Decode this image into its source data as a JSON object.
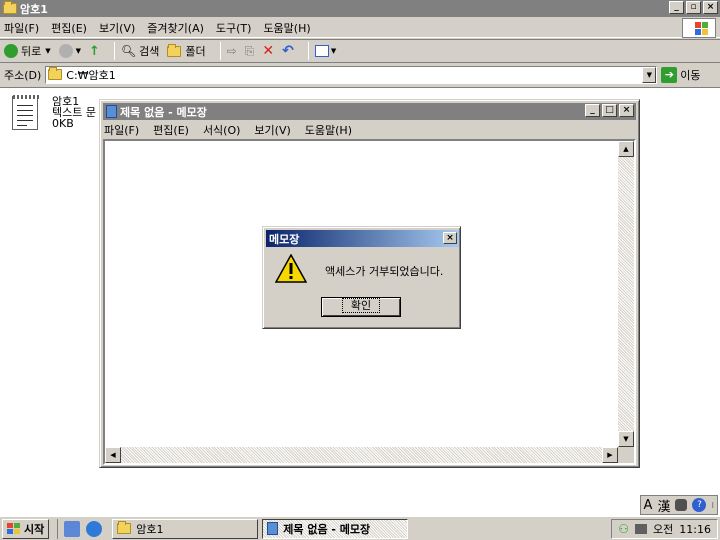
{
  "explorer": {
    "title": "암호1",
    "menu": [
      "파일(F)",
      "편집(E)",
      "보기(V)",
      "즐겨찾기(A)",
      "도구(T)",
      "도움말(H)"
    ],
    "toolbar": {
      "back": "뒤로",
      "search": "검색",
      "folders": "폴더"
    },
    "address": {
      "label": "주소(D)",
      "value": "C:₩암호1",
      "go": "이동"
    },
    "file": {
      "name": "암호1",
      "type": "텍스트 문",
      "size": "0KB"
    }
  },
  "notepad": {
    "title": "제목 없음 - 메모장",
    "menu": [
      "파일(F)",
      "편집(E)",
      "서식(O)",
      "보기(V)",
      "도움말(H)"
    ]
  },
  "dialog": {
    "title": "메모장",
    "message": "액세스가 거부되었습니다.",
    "ok": "확인"
  },
  "taskbar": {
    "start": "시작",
    "tasks": [
      "암호1",
      "제목 없음 - 메모장"
    ],
    "clock_ampm": "오전",
    "clock_time": "11:16"
  },
  "langbar": {
    "a": "A",
    "hanja": "漢"
  },
  "colors": {
    "dialog_title_start": "#0a246a",
    "warning": "#f5d800"
  }
}
